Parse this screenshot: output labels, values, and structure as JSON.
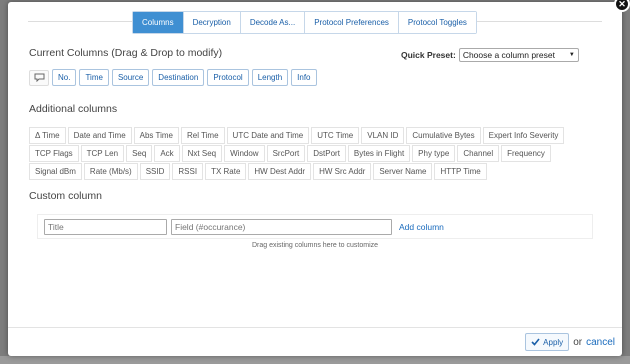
{
  "tabs": [
    {
      "label": "Columns",
      "active": true
    },
    {
      "label": "Decryption",
      "active": false
    },
    {
      "label": "Decode As...",
      "active": false
    },
    {
      "label": "Protocol Preferences",
      "active": false
    },
    {
      "label": "Protocol Toggles",
      "active": false
    }
  ],
  "current": {
    "title": "Current Columns (Drag & Drop to modify)",
    "columns": [
      "No.",
      "Time",
      "Source",
      "Destination",
      "Protocol",
      "Length",
      "Info"
    ]
  },
  "quick_preset": {
    "label": "Quick Preset:",
    "value": "Choose a column preset"
  },
  "additional": {
    "title": "Additional columns",
    "rows": [
      [
        "Δ Time",
        "Date and Time",
        "Abs Time",
        "Rel Time",
        "UTC Date and Time",
        "UTC Time",
        "VLAN ID",
        "Cumulative Bytes",
        "Expert Info Severity"
      ],
      [
        "TCP Flags",
        "TCP Len",
        "Seq",
        "Ack",
        "Nxt Seq",
        "Window",
        "SrcPort",
        "DstPort",
        "Bytes in Flight",
        "Phy type",
        "Channel",
        "Frequency"
      ],
      [
        "Signal dBm",
        "Rate (Mb/s)",
        "SSID",
        "RSSI",
        "TX Rate",
        "HW Dest Addr",
        "HW Src Addr",
        "Server Name",
        "HTTP Time"
      ]
    ]
  },
  "custom": {
    "title": "Custom column",
    "title_placeholder": "Title",
    "field_placeholder": "Field (#occurance)",
    "add_label": "Add column",
    "drag_hint": "Drag existing columns here to customize"
  },
  "footer": {
    "apply_label": "Apply",
    "or_text": "or",
    "cancel_label": "cancel"
  },
  "colors": {
    "accent": "#3f8fd2",
    "link": "#1a6bbd"
  }
}
